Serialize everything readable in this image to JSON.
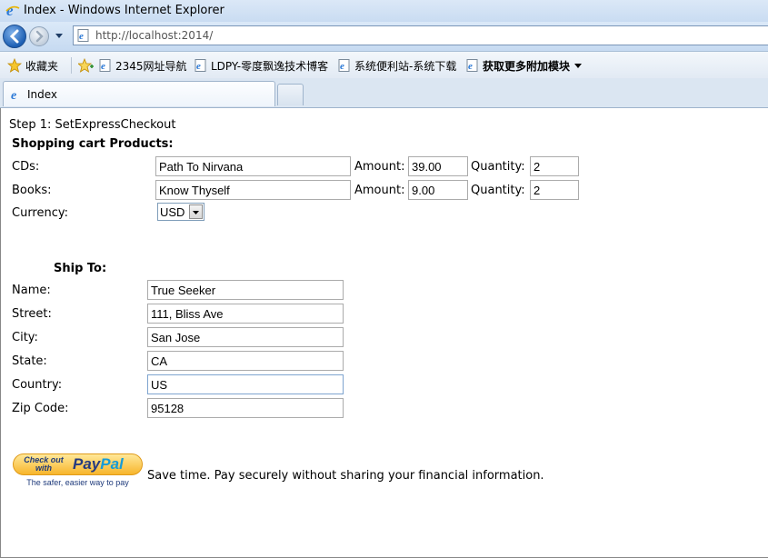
{
  "window": {
    "title": "Index - Windows Internet Explorer"
  },
  "address_bar": {
    "url": "http://localhost:2014/"
  },
  "favorites_bar": {
    "favorites_label": "收藏夹",
    "links": [
      "2345网址导航",
      "LDPY-零度飘逸技术博客",
      "系统便利站-系统下载"
    ],
    "addons_label": "获取更多附加模块"
  },
  "tabs": [
    {
      "label": "Index"
    }
  ],
  "page": {
    "step_title": "Step 1: SetExpressCheckout",
    "cart_heading": "Shopping cart Products:",
    "cd_label": "CDs:",
    "cd_name": "Path To Nirvana",
    "cd_amount_label": "Amount:",
    "cd_amount": "39.00",
    "cd_qty_label": "Quantity:",
    "cd_qty": "2",
    "book_label": "Books:",
    "book_name": "Know Thyself",
    "book_amount_label": "Amount:",
    "book_amount": "9.00",
    "book_qty_label": "Quantity:",
    "book_qty": "2",
    "currency_label": "Currency:",
    "currency_value": "USD",
    "ship_heading": "Ship To:",
    "name_label": "Name:",
    "name_value": "True Seeker",
    "street_label": "Street:",
    "street_value": "111, Bliss Ave",
    "city_label": "City:",
    "city_value": "San Jose",
    "state_label": "State:",
    "state_value": "CA",
    "country_label": "Country:",
    "country_value": "US",
    "zip_label": "Zip Code:",
    "zip_value": "95128",
    "paypal_button": {
      "checkout_text": "Check out with",
      "brand_pay": "Pay",
      "brand_pal": "Pal",
      "tagline": "The safer, easier way to pay"
    },
    "paypal_message": "Save time. Pay securely without sharing your financial information."
  },
  "colors": {
    "ie_blue": "#1d5fb4",
    "paypal_gold": "#f7b52c",
    "paypal_navy": "#253b80",
    "paypal_light": "#179bd7"
  }
}
